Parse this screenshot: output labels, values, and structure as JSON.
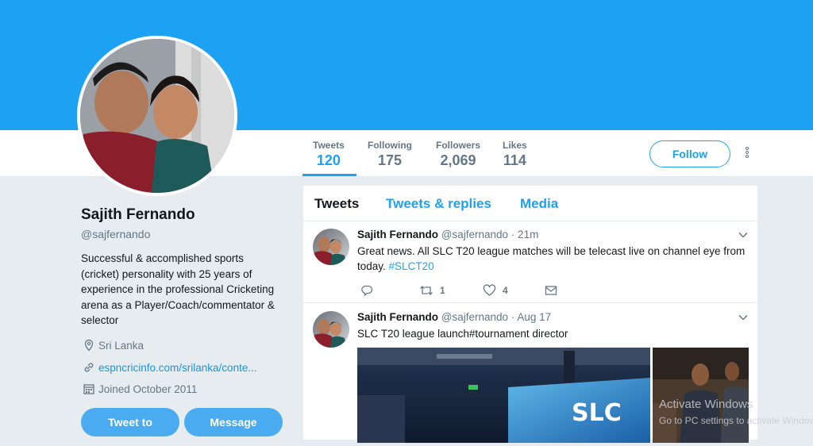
{
  "profile": {
    "name": "Sajith Fernando",
    "handle": "@sajfernando",
    "bio": "Successful & accomplished sports (cricket) personality with 25 years of experience in the professional Cricketing arena as a Player/Coach/commentator & selector",
    "location": "Sri Lanka",
    "website": "espncricinfo.com/srilanka/conte...",
    "joined": "Joined October 2011",
    "buttons": {
      "tweet_to": "Tweet to",
      "message": "Message"
    }
  },
  "stats": [
    {
      "label": "Tweets",
      "value": "120"
    },
    {
      "label": "Following",
      "value": "175"
    },
    {
      "label": "Followers",
      "value": "2,069"
    },
    {
      "label": "Likes",
      "value": "114"
    }
  ],
  "follow_label": "Follow",
  "timeline": {
    "tabs": [
      "Tweets",
      "Tweets & replies",
      "Media"
    ],
    "tweets": [
      {
        "author": "Sajith Fernando",
        "handle": "@sajfernando",
        "time": "· 21m",
        "text": "Great news. All SLC T20 league matches will be telecast live on channel eye from today.",
        "hashtag": "#SLCT20",
        "retweets": "1",
        "likes": "4"
      },
      {
        "author": "Sajith Fernando",
        "handle": "@sajfernando",
        "time": "· Aug 17",
        "text": "SLC T20 league launch#tournament director",
        "media_text": "SLC"
      }
    ]
  },
  "watermark": {
    "title": "Activate Windows",
    "subtitle": "Go to PC settings to activate Windows."
  },
  "colors": {
    "brand": "#1da1f2",
    "banner": "#1da1f2",
    "page_bg": "#e6ecf0"
  },
  "icons": [
    "location-icon",
    "link-icon",
    "calendar-icon",
    "reply-icon",
    "retweet-icon",
    "like-icon",
    "dm-icon",
    "caret-down-icon",
    "more-vertical-icon"
  ]
}
